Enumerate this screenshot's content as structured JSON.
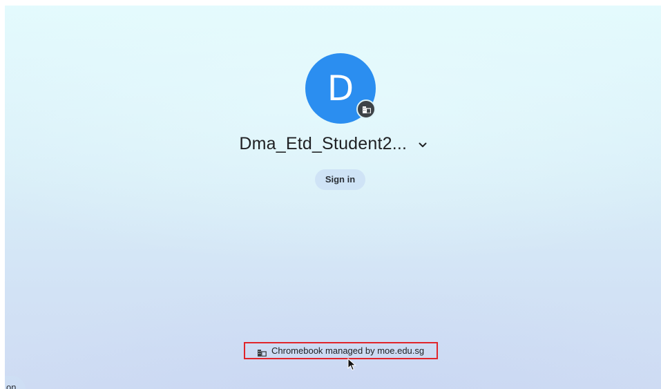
{
  "user": {
    "avatar_letter": "D",
    "name": "Dma_Etd_Student2...",
    "avatar_color": "#2b8ef0"
  },
  "signin_button": {
    "label": "Sign in"
  },
  "managed_notice": {
    "text": "Chromebook managed by moe.edu.sg",
    "highlight_color": "#e0242a"
  },
  "shelf": {
    "partial_label": "on"
  },
  "icons": {
    "enterprise": "building-icon",
    "dropdown": "chevron-down-icon",
    "pointer": "mouse-cursor-icon"
  }
}
